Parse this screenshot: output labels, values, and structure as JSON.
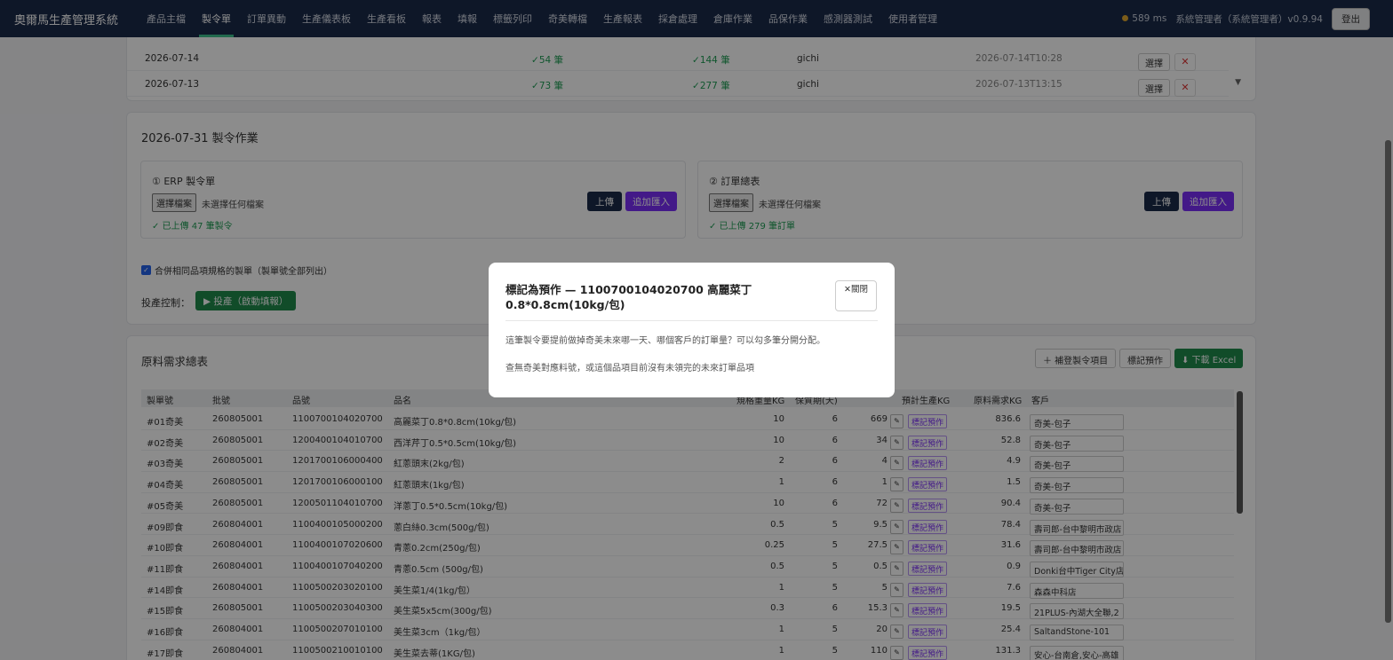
{
  "app": {
    "title": "奧爾馬生產管理系統"
  },
  "nav": {
    "items": [
      "產品主檔",
      "製令單",
      "訂單異動",
      "生產儀表板",
      "生產看板",
      "報表",
      "填報",
      "標籤列印",
      "奇美轉檔",
      "生產報表",
      "採倉處理",
      "倉庫作業",
      "品保作業",
      "感測器測試",
      "使用者管理"
    ],
    "active": "製令單"
  },
  "header": {
    "latency": "589 ms",
    "user": "系統管理者（系統管理者）v0.9.94",
    "logout": "登出"
  },
  "batch_list": {
    "rows": [
      {
        "date": "2026-07-14",
        "orders": "54 筆",
        "items": "144 筆",
        "user": "gichi",
        "time": "2026-07-14T10:28"
      },
      {
        "date": "2026-07-13",
        "orders": "73 筆",
        "items": "277 筆",
        "user": "gichi",
        "time": "2026-07-13T13:15"
      }
    ],
    "select_label": "選擇",
    "check": "✓",
    "delete_icon": "✕",
    "scroll_icon": "▼"
  },
  "order_section": {
    "title": "2026-07-31 製令作業",
    "erp": {
      "title": "① ERP 製令單",
      "file_button": "選擇檔案",
      "file_status": "未選擇任何檔案",
      "uploaded": "✓ 已上傳 47 筆製令",
      "upload": "上傳",
      "append": "追加匯入"
    },
    "orders": {
      "title": "② 訂單總表",
      "file_button": "選擇檔案",
      "file_status": "未選擇任何檔案",
      "uploaded": "✓ 已上傳 279 筆訂單",
      "upload": "上傳",
      "append": "追加匯入"
    },
    "merge_label": "合併相同品項規格的製單（製單號全部列出）",
    "checkbox_mark": "✓",
    "production_control_label": "投產控制：",
    "production_button": "▶ 投產（啟動填報）"
  },
  "materials": {
    "title": "原料需求總表",
    "buttons": {
      "add": "＋ 補登製令項目",
      "mark": "標記預作",
      "excel": "⬇ 下載 Excel"
    },
    "columns": [
      "製單號",
      "批號",
      "品號",
      "品名",
      "規格重量KG",
      "保質期(天)",
      "預計生產KG",
      "原料需求KG",
      "客戶"
    ],
    "edit_icon": "✎",
    "mark_label": "標記預作",
    "rows": [
      {
        "order": "#01奇美",
        "batch": "260805001",
        "code": "1100700104020700",
        "name": "高麗菜丁0.8*0.8cm(10kg/包)",
        "spec": "10",
        "shelf": "6",
        "plan": "669",
        "need": "836.6",
        "customer": "奇美-包子"
      },
      {
        "order": "#02奇美",
        "batch": "260805001",
        "code": "1200400104010700",
        "name": "西洋芹丁0.5*0.5cm(10kg/包)",
        "spec": "10",
        "shelf": "6",
        "plan": "34",
        "need": "52.8",
        "customer": "奇美-包子"
      },
      {
        "order": "#03奇美",
        "batch": "260805001",
        "code": "1201700106000400",
        "name": "紅蔥頭末(2kg/包)",
        "spec": "2",
        "shelf": "6",
        "plan": "4",
        "need": "4.9",
        "customer": "奇美-包子"
      },
      {
        "order": "#04奇美",
        "batch": "260805001",
        "code": "1201700106000100",
        "name": "紅蔥頭末(1kg/包)",
        "spec": "1",
        "shelf": "6",
        "plan": "1",
        "need": "1.5",
        "customer": "奇美-包子"
      },
      {
        "order": "#05奇美",
        "batch": "260805001",
        "code": "1200501104010700",
        "name": "洋蔥丁0.5*0.5cm(10kg/包)",
        "spec": "10",
        "shelf": "6",
        "plan": "72",
        "need": "90.4",
        "customer": "奇美-包子"
      },
      {
        "order": "#09即食",
        "batch": "260804001",
        "code": "1100400105000200",
        "name": "蔥白絲0.3cm(500g/包)",
        "spec": "0.5",
        "shelf": "5",
        "plan": "9.5",
        "need": "78.4",
        "customer": "壽司郎-台中黎明市政店"
      },
      {
        "order": "#10即食",
        "batch": "260804001",
        "code": "1100400107020600",
        "name": "青蔥0.2cm(250g/包)",
        "spec": "0.25",
        "shelf": "5",
        "plan": "27.5",
        "need": "31.6",
        "customer": "壽司郎-台中黎明市政店"
      },
      {
        "order": "#11即食",
        "batch": "260804001",
        "code": "1100400107040200",
        "name": "青蔥0.5cm (500g/包)",
        "spec": "0.5",
        "shelf": "5",
        "plan": "0.5",
        "need": "0.9",
        "customer": "Donki台中Tiger City店"
      },
      {
        "order": "#14即食",
        "batch": "260804001",
        "code": "1100500203020100",
        "name": "美生菜1/4(1kg/包）",
        "spec": "1",
        "shelf": "5",
        "plan": "5",
        "need": "7.6",
        "customer": "森森中科店"
      },
      {
        "order": "#15即食",
        "batch": "260805001",
        "code": "1100500203040300",
        "name": "美生菜5x5cm(300g/包)",
        "spec": "0.3",
        "shelf": "6",
        "plan": "15.3",
        "need": "19.5",
        "customer": "21PLUS-內湖大全聯,2"
      },
      {
        "order": "#16即食",
        "batch": "260804001",
        "code": "1100500207010100",
        "name": "美生菜3cm（1kg/包）",
        "spec": "1",
        "shelf": "5",
        "plan": "20",
        "need": "25.4",
        "customer": "SaltandStone-101"
      },
      {
        "order": "#17即食",
        "batch": "260804001",
        "code": "1100500210010100",
        "name": "美生菜去蒂(1KG/包)",
        "spec": "1",
        "shelf": "5",
        "plan": "110",
        "need": "131.3",
        "customer": "安心-台南倉,安心-高雄"
      }
    ]
  },
  "modal": {
    "title": "標記為預作 — 1100700104020700 高麗菜丁0.8*0.8cm(10kg/包)",
    "close_icon": "✕",
    "close": "關閉",
    "description": "這筆製令要提前做掉奇美未來哪一天、哪個客戶的訂單量？可以勾多筆分開分配。",
    "empty": "查無奇美對應料號，或這個品項目前沒有未領完的未來訂單品項"
  }
}
